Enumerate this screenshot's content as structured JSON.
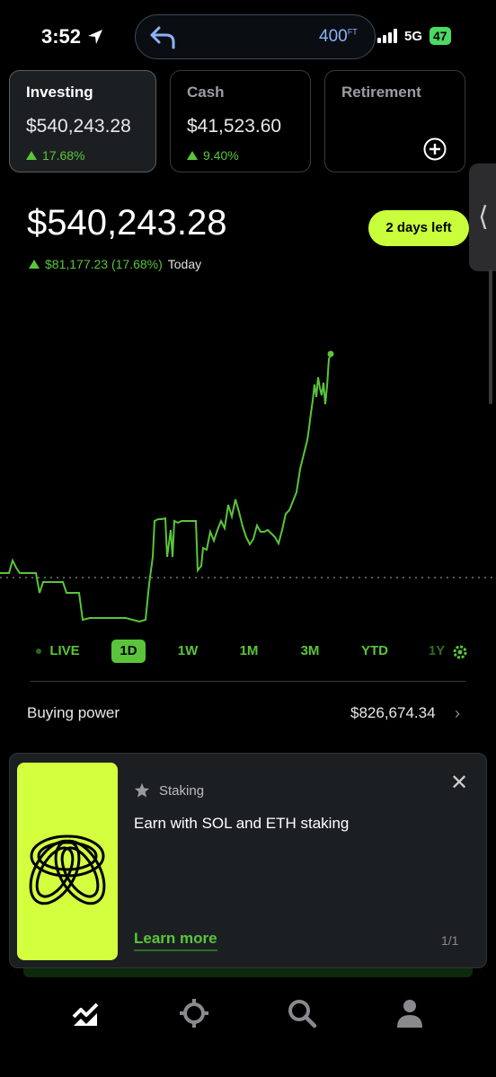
{
  "status_bar": {
    "time": "3:52",
    "altitude": "400",
    "altitude_unit": "FT",
    "network": "5G",
    "battery": "47"
  },
  "accounts": [
    {
      "name": "Investing",
      "value": "$540,243.28",
      "change": "17.68%"
    },
    {
      "name": "Cash",
      "value": "$41,523.60",
      "change": "9.40%"
    },
    {
      "name": "Retirement"
    }
  ],
  "portfolio": {
    "value": "$540,243.28",
    "change": "$81,177.23 (17.68%)",
    "change_period": "Today",
    "badge": "2 days left"
  },
  "ranges": [
    "LIVE",
    "1D",
    "1W",
    "1M",
    "3M",
    "YTD",
    "1Y"
  ],
  "selected_range": "1D",
  "buying_power": {
    "label": "Buying power",
    "value": "$826,674.34"
  },
  "promo": {
    "tag": "Staking",
    "title": "Earn with SOL and ETH staking",
    "link": "Learn more",
    "page": "1/1"
  },
  "colors": {
    "accent": "#5ac53a",
    "highlight": "#c8ff3a",
    "background": "#000000"
  }
}
